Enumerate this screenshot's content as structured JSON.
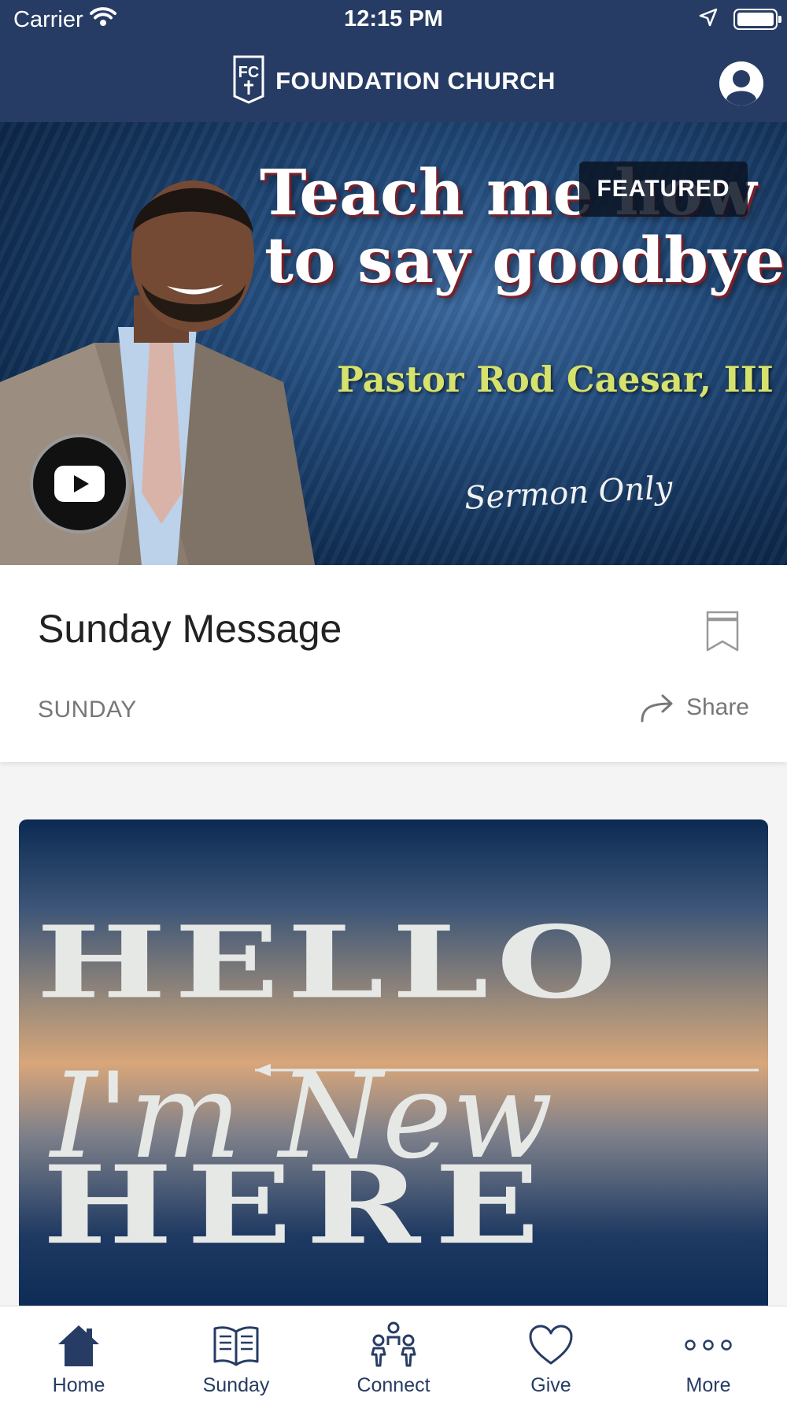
{
  "status_bar": {
    "carrier": "Carrier",
    "time": "12:15 PM"
  },
  "header": {
    "title": "FOUNDATION CHURCH",
    "logo_letters": "FC"
  },
  "featured": {
    "badge": "FEATURED",
    "line1": "Teach me how",
    "line2": "to say goodbye",
    "pastor": "Pastor Rod Caesar, III",
    "subtitle": "Sermon Only"
  },
  "sermon_card": {
    "title": "Sunday Message",
    "category": "SUNDAY",
    "share_label": "Share"
  },
  "promo_card": {
    "line1": "HELLO",
    "line2": "I'm New",
    "line3": "HERE"
  },
  "tabs": [
    {
      "label": "Home",
      "icon": "home-icon"
    },
    {
      "label": "Sunday",
      "icon": "book-icon"
    },
    {
      "label": "Connect",
      "icon": "people-icon"
    },
    {
      "label": "Give",
      "icon": "heart-icon"
    },
    {
      "label": "More",
      "icon": "more-icon"
    }
  ],
  "colors": {
    "header_bg": "#273c64",
    "accent": "#273c64"
  }
}
